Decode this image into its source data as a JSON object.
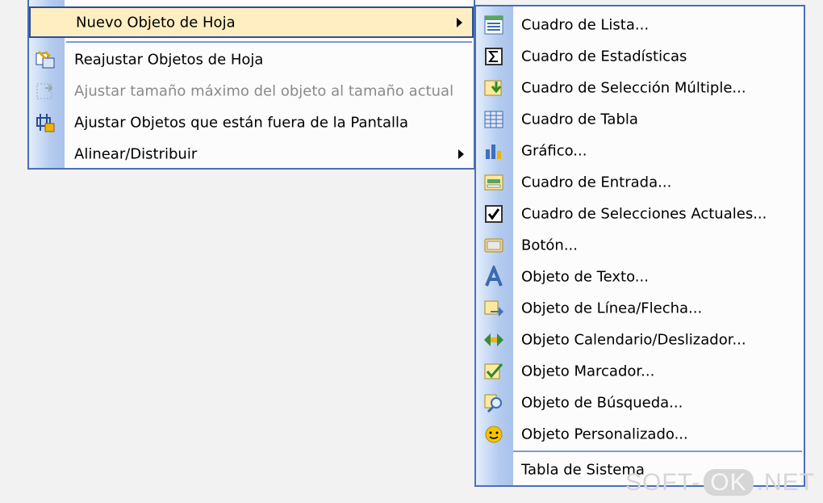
{
  "main_menu": {
    "items": [
      {
        "label": "Nuevo Objeto de Hoja",
        "icon": "none",
        "highlight": true,
        "submenu": true,
        "disabled": false
      },
      {
        "label": "Reajustar Objetos de Hoja",
        "icon": "reset-objects-icon",
        "disabled": false
      },
      {
        "label": "Ajustar tamaño máximo del objeto al tamaño actual",
        "icon": "resize-max-icon",
        "disabled": true
      },
      {
        "label": "Ajustar Objetos que están fuera de la Pantalla",
        "icon": "adjust-offscreen-icon",
        "disabled": false
      },
      {
        "label": "Alinear/Distribuir",
        "icon": "none",
        "submenu": true,
        "disabled": false
      }
    ]
  },
  "sub_menu": {
    "items": [
      {
        "label": "Cuadro de Lista...",
        "icon": "list-box-icon"
      },
      {
        "label": "Cuadro de Estadísticas",
        "icon": "statistics-sigma-icon"
      },
      {
        "label": "Cuadro de Selección Múltiple...",
        "icon": "multi-select-icon"
      },
      {
        "label": "Cuadro de Tabla",
        "icon": "table-grid-icon"
      },
      {
        "label": "Gráfico...",
        "icon": "bar-chart-icon"
      },
      {
        "label": "Cuadro de Entrada...",
        "icon": "input-box-icon"
      },
      {
        "label": "Cuadro de Selecciones Actuales...",
        "icon": "checkmark-icon"
      },
      {
        "label": "Botón...",
        "icon": "button-icon"
      },
      {
        "label": "Objeto de Texto...",
        "icon": "text-a-icon"
      },
      {
        "label": "Objeto de Línea/Flecha...",
        "icon": "arrow-icon"
      },
      {
        "label": "Objeto Calendario/Deslizador...",
        "icon": "slider-icon"
      },
      {
        "label": "Objeto Marcador...",
        "icon": "bookmark-star-icon"
      },
      {
        "label": "Objeto de Búsqueda...",
        "icon": "magnifier-icon"
      },
      {
        "label": "Objeto Personalizado...",
        "icon": "smiley-icon"
      },
      {
        "label": "Tabla de Sistema",
        "icon": "none"
      }
    ]
  },
  "watermark": {
    "left": "SOFT-",
    "middle": "OK",
    "right": ".NET"
  },
  "colors": {
    "highlight": "#ffeec2",
    "border": "#2c4f96",
    "gutter": "#b5ccef"
  }
}
